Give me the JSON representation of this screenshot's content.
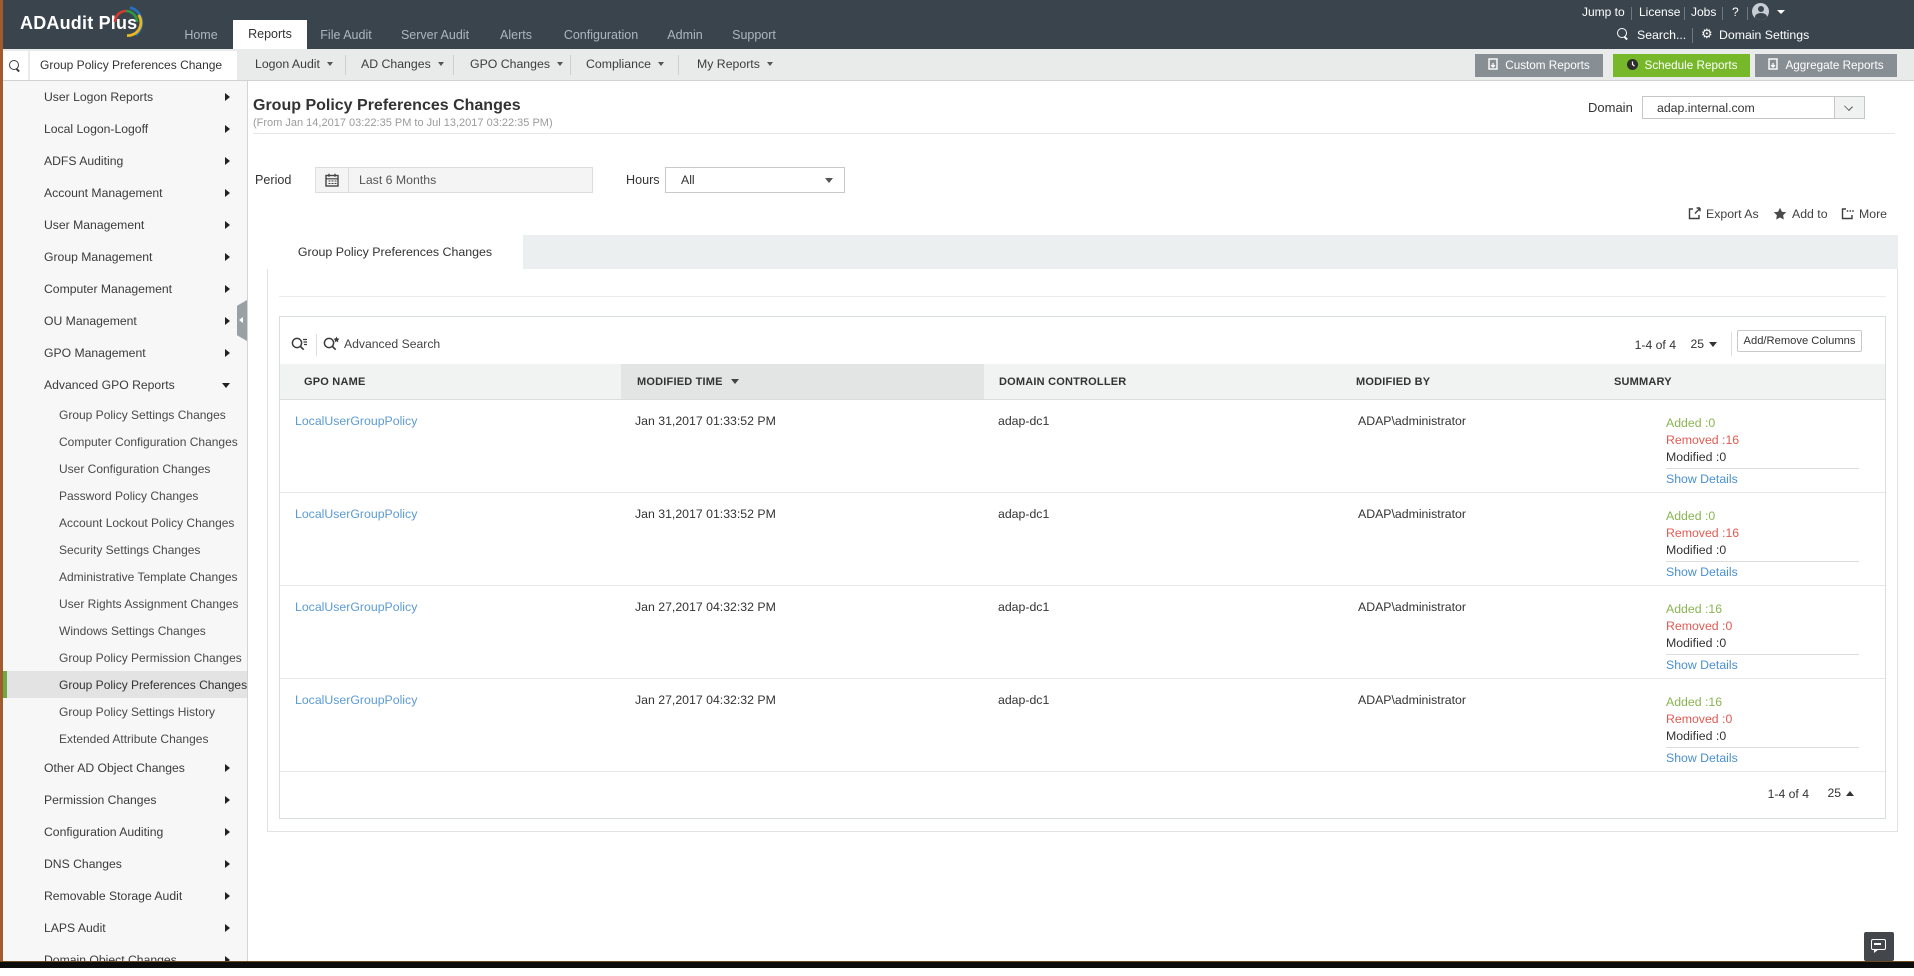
{
  "topbar": {
    "logo": "ADAudit Plus",
    "nav": [
      {
        "label": "Home",
        "active": false
      },
      {
        "label": "Reports",
        "active": true
      },
      {
        "label": "File Audit",
        "active": false
      },
      {
        "label": "Server Audit",
        "active": false
      },
      {
        "label": "Alerts",
        "active": false
      },
      {
        "label": "Configuration",
        "active": false
      },
      {
        "label": "Admin",
        "active": false
      },
      {
        "label": "Support",
        "active": false
      }
    ],
    "links": {
      "jump_to": "Jump to",
      "license": "License",
      "jobs": "Jobs",
      "help": "?"
    },
    "search_label": "Search...",
    "domain_settings_label": "Domain Settings"
  },
  "toolbar": {
    "report_search_value": "Group Policy Preferences Change",
    "menus": [
      "Logon Audit",
      "AD Changes",
      "GPO Changes",
      "Compliance",
      "My Reports"
    ],
    "custom_reports": "Custom Reports",
    "schedule_reports": "Schedule Reports",
    "aggregate_reports": "Aggregate Reports"
  },
  "sidebar": {
    "items": [
      {
        "label": "User Logon Reports",
        "type": "top"
      },
      {
        "label": "Local Logon-Logoff",
        "type": "top"
      },
      {
        "label": "ADFS Auditing",
        "type": "top"
      },
      {
        "label": "Account Management",
        "type": "top"
      },
      {
        "label": "User Management",
        "type": "top"
      },
      {
        "label": "Group Management",
        "type": "top"
      },
      {
        "label": "Computer Management",
        "type": "top"
      },
      {
        "label": "OU Management",
        "type": "top"
      },
      {
        "label": "GPO Management",
        "type": "top"
      },
      {
        "label": "Advanced GPO Reports",
        "type": "top",
        "expanded": true
      },
      {
        "label": "Group Policy Settings Changes",
        "type": "sub"
      },
      {
        "label": "Computer Configuration Changes",
        "type": "sub"
      },
      {
        "label": "User Configuration Changes",
        "type": "sub"
      },
      {
        "label": "Password Policy Changes",
        "type": "sub"
      },
      {
        "label": "Account Lockout Policy Changes",
        "type": "sub"
      },
      {
        "label": "Security Settings Changes",
        "type": "sub"
      },
      {
        "label": "Administrative Template Changes",
        "type": "sub"
      },
      {
        "label": "User Rights Assignment Changes",
        "type": "sub"
      },
      {
        "label": "Windows Settings Changes",
        "type": "sub"
      },
      {
        "label": "Group Policy Permission Changes",
        "type": "sub"
      },
      {
        "label": "Group Policy Preferences Changes",
        "type": "sub",
        "selected": true
      },
      {
        "label": "Group Policy Settings History",
        "type": "sub"
      },
      {
        "label": "Extended Attribute Changes",
        "type": "sub"
      },
      {
        "label": "Other AD Object Changes",
        "type": "top"
      },
      {
        "label": "Permission Changes",
        "type": "top"
      },
      {
        "label": "Configuration Auditing",
        "type": "top"
      },
      {
        "label": "DNS Changes",
        "type": "top"
      },
      {
        "label": "Removable Storage Audit",
        "type": "top"
      },
      {
        "label": "LAPS Audit",
        "type": "top"
      },
      {
        "label": "Domain Object Changes",
        "type": "top"
      }
    ]
  },
  "report": {
    "title": "Group Policy Preferences Changes",
    "subtitle": "(From Jan 14,2017 03:22:35 PM to Jul 13,2017 03:22:35 PM)",
    "domain_label": "Domain",
    "domain_value": "adap.internal.com",
    "period_label": "Period",
    "period_value": "Last 6 Months",
    "hours_label": "Hours",
    "hours_value": "All",
    "export_as": "Export As",
    "add_to": "Add to",
    "more": "More",
    "tab": "Group Policy Preferences Changes",
    "advanced_search": "Advanced Search",
    "pagination": "1-4 of 4",
    "page_size": "25",
    "add_remove_columns": "Add/Remove Columns",
    "pagination_bottom": "1-4 of 4",
    "page_size_bottom": "25"
  },
  "table": {
    "columns": [
      "GPO NAME",
      "MODIFIED TIME",
      "DOMAIN CONTROLLER",
      "MODIFIED BY",
      "SUMMARY"
    ],
    "sort_column": "MODIFIED TIME",
    "show_details_label": "Show Details",
    "rows": [
      {
        "gpo": "LocalUserGroupPolicy",
        "time": "Jan 31,2017 01:33:52 PM",
        "dc": "adap-dc1",
        "by": "ADAP\\administrator",
        "added": "Added :0",
        "removed": "Removed :16",
        "modified": "Modified :0"
      },
      {
        "gpo": "LocalUserGroupPolicy",
        "time": "Jan 31,2017 01:33:52 PM",
        "dc": "adap-dc1",
        "by": "ADAP\\administrator",
        "added": "Added :0",
        "removed": "Removed :16",
        "modified": "Modified :0"
      },
      {
        "gpo": "LocalUserGroupPolicy",
        "time": "Jan 27,2017 04:32:32 PM",
        "dc": "adap-dc1",
        "by": "ADAP\\administrator",
        "added": "Added :16",
        "removed": "Removed :0",
        "modified": "Modified :0"
      },
      {
        "gpo": "LocalUserGroupPolicy",
        "time": "Jan 27,2017 04:32:32 PM",
        "dc": "adap-dc1",
        "by": "ADAP\\administrator",
        "added": "Added :16",
        "removed": "Removed :0",
        "modified": "Modified :0"
      }
    ]
  },
  "colors": {
    "accent_green": "#76b82a",
    "added": "#8ab452",
    "removed": "#e05a52",
    "link": "#4a90d2"
  }
}
